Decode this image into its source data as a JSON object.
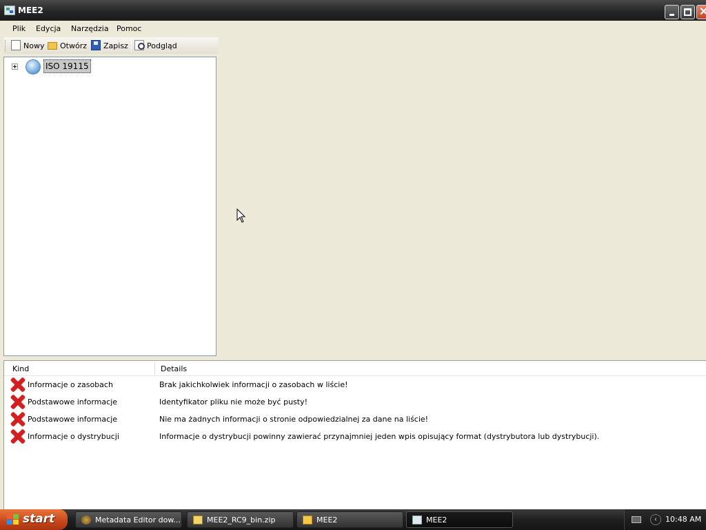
{
  "window": {
    "title": "MEE2",
    "icon": "app-icon",
    "controls": [
      "minimize-icon",
      "maximize-icon",
      "close-icon"
    ]
  },
  "menubar": {
    "items": [
      "Plik",
      "Edycja",
      "Narzędzia",
      "Pomoc"
    ]
  },
  "toolbar": {
    "new_label": "Nowy",
    "open_label": "Otwórz",
    "save_label": "Zapisz",
    "preview_label": "Podgląd"
  },
  "tree": {
    "root_label": "ISO 19115",
    "root_icon": "globe-icon",
    "root_expanded": false
  },
  "error_list": {
    "columns": [
      "Kind",
      "Details"
    ],
    "rows": [
      {
        "kind": "Informacje o zasobach",
        "details": "Brak jakichkolwiek informacji o zasobach w liście!",
        "icon": "error-icon"
      },
      {
        "kind": "Podstawowe informacje",
        "details": "Identyfikator pliku nie może być pusty!",
        "icon": "error-icon"
      },
      {
        "kind": "Podstawowe informacje",
        "details": "Nie ma żadnych informacji o stronie odpowiedzialnej za dane na liście!",
        "icon": "error-icon"
      },
      {
        "kind": "Informacje o dystrybucji",
        "details": "Informacje o dystrybucji powinny zawierać przynajmniej jeden wpis opisujący format (dystrybutora lub dystrybucji).",
        "icon": "error-icon"
      }
    ]
  },
  "taskbar": {
    "start_label": "start",
    "tasks": [
      {
        "label": "Metadata Editor dow...",
        "icon": "browser-icon",
        "active": false
      },
      {
        "label": "MEE2_RC9_bin.zip",
        "icon": "zip-icon",
        "active": false
      },
      {
        "label": "MEE2",
        "icon": "folder-icon",
        "active": false
      },
      {
        "label": "MEE2",
        "icon": "app-icon",
        "active": true
      }
    ],
    "clock": "10:48 AM"
  },
  "colors": {
    "titlebar": "#262626",
    "error_red": "#d42020",
    "start_orange": "#c7461b",
    "panel_background": "#ECE9D8"
  }
}
